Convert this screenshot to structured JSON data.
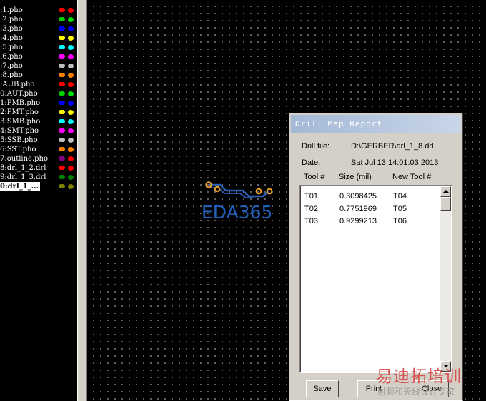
{
  "layers": [
    {
      "name": ":1.pho",
      "c1": "#ff0000",
      "c2": "#ff0000"
    },
    {
      "name": ":2.pho",
      "c1": "#00cc00",
      "c2": "#00dd00"
    },
    {
      "name": ":3.pho",
      "c1": "#0000ff",
      "c2": "#0000ff"
    },
    {
      "name": ":4.pho",
      "c1": "#ffff00",
      "c2": "#ffff00"
    },
    {
      "name": ":5.pho",
      "c1": "#00ffff",
      "c2": "#00ffff"
    },
    {
      "name": ":6.pho",
      "c1": "#ff00ff",
      "c2": "#ff00ff"
    },
    {
      "name": ":7.pho",
      "c1": "#c0c0c0",
      "c2": "#c0c0c0"
    },
    {
      "name": ":8.pho",
      "c1": "#ff8000",
      "c2": "#ff8000"
    },
    {
      "name": ":AUB.pho",
      "c1": "#ff0000",
      "c2": "#ff0000"
    },
    {
      "name": "0:AUT.pho",
      "c1": "#00cc00",
      "c2": "#00dd00"
    },
    {
      "name": "1:PMB.pho",
      "c1": "#0000ff",
      "c2": "#0000ff"
    },
    {
      "name": "2:PMT.pho",
      "c1": "#ffff00",
      "c2": "#ffff00"
    },
    {
      "name": "3:SMB.pho",
      "c1": "#00ffff",
      "c2": "#00ffff"
    },
    {
      "name": "4:SMT.pho",
      "c1": "#ff00ff",
      "c2": "#ff00ff"
    },
    {
      "name": "5:SSB.pho",
      "c1": "#c0c0c0",
      "c2": "#c0c0c0"
    },
    {
      "name": "6:SST.pho",
      "c1": "#ff8000",
      "c2": "#ff8000"
    },
    {
      "name": "7:outline.pho",
      "c1": "#800080",
      "c2": "#ff0000"
    },
    {
      "name": "8:drl_1_2.drl",
      "c1": "#ff0000",
      "c2": "#ff0000"
    },
    {
      "name": "9:drl_1_3.drl",
      "c1": "#008000",
      "c2": "#008000"
    },
    {
      "name": "0:drl_1_...",
      "c1": "#808000",
      "c2": "#808000",
      "active": true
    }
  ],
  "logo": {
    "text": "EDA365"
  },
  "dialog": {
    "title": "Drill Map Report",
    "drill_file_label": "Drill file:",
    "drill_file_value": "D:\\GERBER\\drl_1_8.drl",
    "date_label": "Date:",
    "date_value": "Sat Jul 13 14:01:03 2013",
    "columns": [
      "Tool #",
      "Size (mil)",
      "New Tool #"
    ],
    "rows": [
      [
        "T01",
        "0.3098425",
        "T04"
      ],
      [
        "T02",
        "0.7751969",
        "T05"
      ],
      [
        "T03",
        "0.9299213",
        "T06"
      ]
    ],
    "buttons": {
      "save": "Save",
      "print": "Print",
      "close": "Close"
    }
  },
  "watermark": {
    "main": "易迪拓培训",
    "sub": "射频和天线设计专家"
  }
}
